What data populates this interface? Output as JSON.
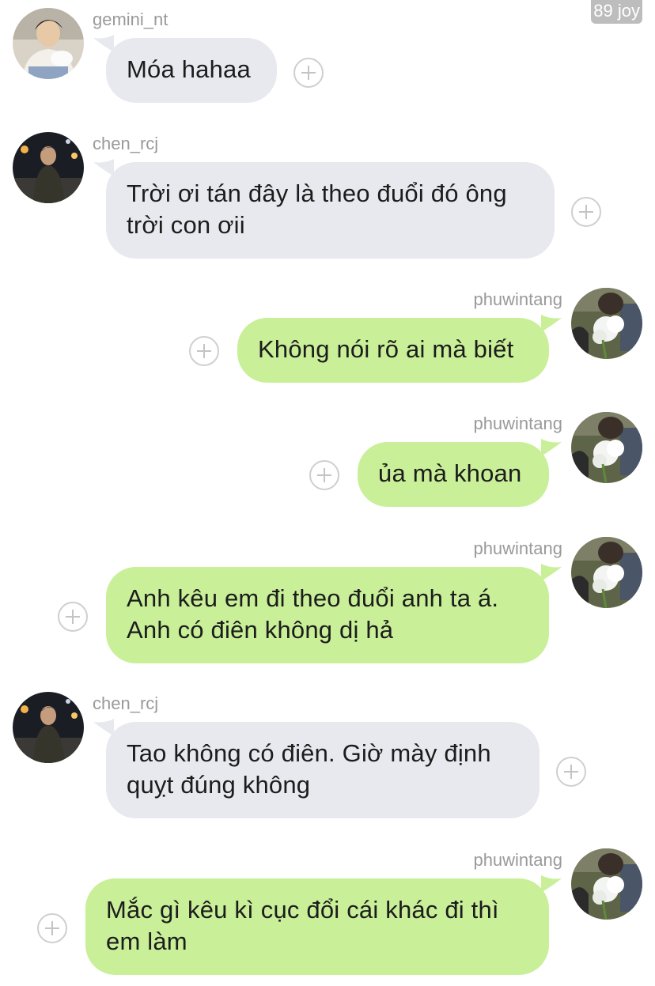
{
  "badge": "89 joy",
  "messages": [
    {
      "user": "gemini_nt",
      "side": "in",
      "avatar": "gemini",
      "lines": [
        "Móa hahaa"
      ]
    },
    {
      "user": "chen_rcj",
      "side": "in",
      "avatar": "chen",
      "lines": [
        "Trời ơi tán đây là theo đuổi đó ông",
        "trời con ơii"
      ]
    },
    {
      "user": "phuwintang",
      "side": "out",
      "avatar": "phuwin",
      "lines": [
        "Không nói rõ ai mà biết"
      ]
    },
    {
      "user": "phuwintang",
      "side": "out",
      "avatar": "phuwin",
      "lines": [
        "ủa mà khoan"
      ]
    },
    {
      "user": "phuwintang",
      "side": "out",
      "avatar": "phuwin",
      "lines": [
        "Anh kêu em đi theo đuổi anh ta á.",
        "Anh có điên không dị hả"
      ]
    },
    {
      "user": "chen_rcj",
      "side": "in",
      "avatar": "chen",
      "lines": [
        "Tao không có điên. Giờ mày định",
        "quỵt đúng không"
      ]
    },
    {
      "user": "phuwintang",
      "side": "out",
      "avatar": "phuwin",
      "lines": [
        "Mắc gì kêu kì cục đổi cái khác đi thì",
        "em làm"
      ]
    }
  ],
  "colors": {
    "incoming_bubble": "#e7e9ee",
    "outgoing_bubble": "#c9ef98",
    "username": "#9a9a9a",
    "react_icon": "#c4c4c4"
  }
}
